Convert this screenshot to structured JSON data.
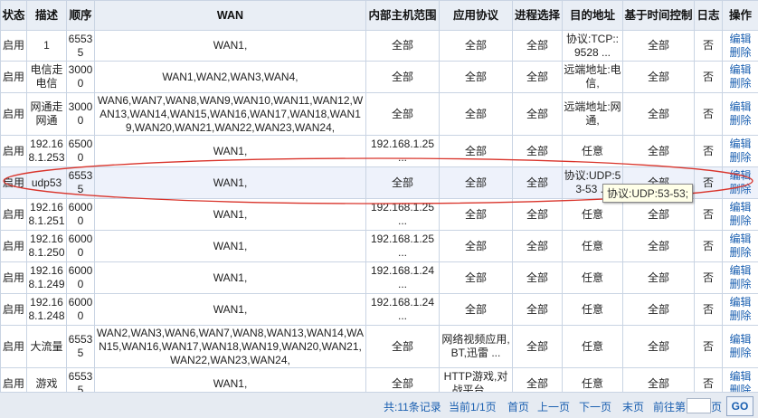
{
  "headers": [
    "状态",
    "描述",
    "顺序",
    "WAN",
    "内部主机范围",
    "应用协议",
    "进程选择",
    "目的地址",
    "基于时间控制",
    "日志",
    "操作"
  ],
  "rows": [
    {
      "status": "启用",
      "desc": "1",
      "order": "65535",
      "wan": "WAN1,",
      "hosts": "全部",
      "proto": "全部",
      "proc": "全部",
      "dest": "协议:TCP::9528 ...",
      "time": "全部",
      "log": "否",
      "edit": "编辑",
      "del": "删除"
    },
    {
      "status": "启用",
      "desc": "电信走电信",
      "order": "30000",
      "wan": "WAN1,WAN2,WAN3,WAN4,",
      "hosts": "全部",
      "proto": "全部",
      "proc": "全部",
      "dest": "远端地址:电信,",
      "time": "全部",
      "log": "否",
      "edit": "编辑",
      "del": "删除"
    },
    {
      "status": "启用",
      "desc": "网通走网通",
      "order": "30000",
      "wan": "WAN6,WAN7,WAN8,WAN9,WAN10,WAN11,WAN12,WAN13,WAN14,WAN15,WAN16,WAN17,WAN18,WAN19,WAN20,WAN21,WAN22,WAN23,WAN24,",
      "hosts": "全部",
      "proto": "全部",
      "proc": "全部",
      "dest": "远端地址:网通,",
      "time": "全部",
      "log": "否",
      "edit": "编辑",
      "del": "删除"
    },
    {
      "status": "启用",
      "desc": "192.168.1.253",
      "order": "65000",
      "wan": "WAN1,",
      "hosts": "192.168.1.25 ...",
      "proto": "全部",
      "proc": "全部",
      "dest": "任意",
      "time": "全部",
      "log": "否",
      "edit": "编辑",
      "del": "删除"
    },
    {
      "status": "启用",
      "desc": "udp53",
      "order": "65535",
      "wan": "WAN1,",
      "hosts": "全部",
      "proto": "全部",
      "proc": "全部",
      "dest": "协议:UDP:53-53 ...",
      "time": "全部",
      "log": "否",
      "edit": "编辑",
      "del": "删除"
    },
    {
      "status": "启用",
      "desc": "192.168.1.251",
      "order": "60000",
      "wan": "WAN1,",
      "hosts": "192.168.1.25 ...",
      "proto": "全部",
      "proc": "全部",
      "dest": "任意",
      "time": "全部",
      "log": "否",
      "edit": "编辑",
      "del": "删除"
    },
    {
      "status": "启用",
      "desc": "192.168.1.250",
      "order": "60000",
      "wan": "WAN1,",
      "hosts": "192.168.1.25 ...",
      "proto": "全部",
      "proc": "全部",
      "dest": "任意",
      "time": "全部",
      "log": "否",
      "edit": "编辑",
      "del": "删除"
    },
    {
      "status": "启用",
      "desc": "192.168.1.249",
      "order": "60000",
      "wan": "WAN1,",
      "hosts": "192.168.1.24 ...",
      "proto": "全部",
      "proc": "全部",
      "dest": "任意",
      "time": "全部",
      "log": "否",
      "edit": "编辑",
      "del": "删除"
    },
    {
      "status": "启用",
      "desc": "192.168.1.248",
      "order": "60000",
      "wan": "WAN1,",
      "hosts": "192.168.1.24 ...",
      "proto": "全部",
      "proc": "全部",
      "dest": "任意",
      "time": "全部",
      "log": "否",
      "edit": "编辑",
      "del": "删除"
    },
    {
      "status": "启用",
      "desc": "大流量",
      "order": "65535",
      "wan": "WAN2,WAN3,WAN6,WAN7,WAN8,WAN13,WAN14,WAN15,WAN16,WAN17,WAN18,WAN19,WAN20,WAN21,WAN22,WAN23,WAN24,",
      "hosts": "全部",
      "proto": "网络视频应用,BT,迅雷 ...",
      "proc": "全部",
      "dest": "任意",
      "time": "全部",
      "log": "否",
      "edit": "编辑",
      "del": "删除"
    },
    {
      "status": "启用",
      "desc": "游戏",
      "order": "65535",
      "wan": "WAN1,",
      "hosts": "全部",
      "proto": "HTTP游戏,对战平台, ...",
      "proc": "全部",
      "dest": "任意",
      "time": "全部",
      "log": "否",
      "edit": "编辑",
      "del": "删除"
    }
  ],
  "pager": {
    "summary": "共:11条记录",
    "current": "当前1/1页",
    "first": "首页",
    "prev": "上一页",
    "next": "下一页",
    "last": "末页",
    "goto_prefix": "前往第",
    "goto_suffix": "页",
    "go": "GO"
  },
  "tooltip": "协议:UDP:53-53;"
}
